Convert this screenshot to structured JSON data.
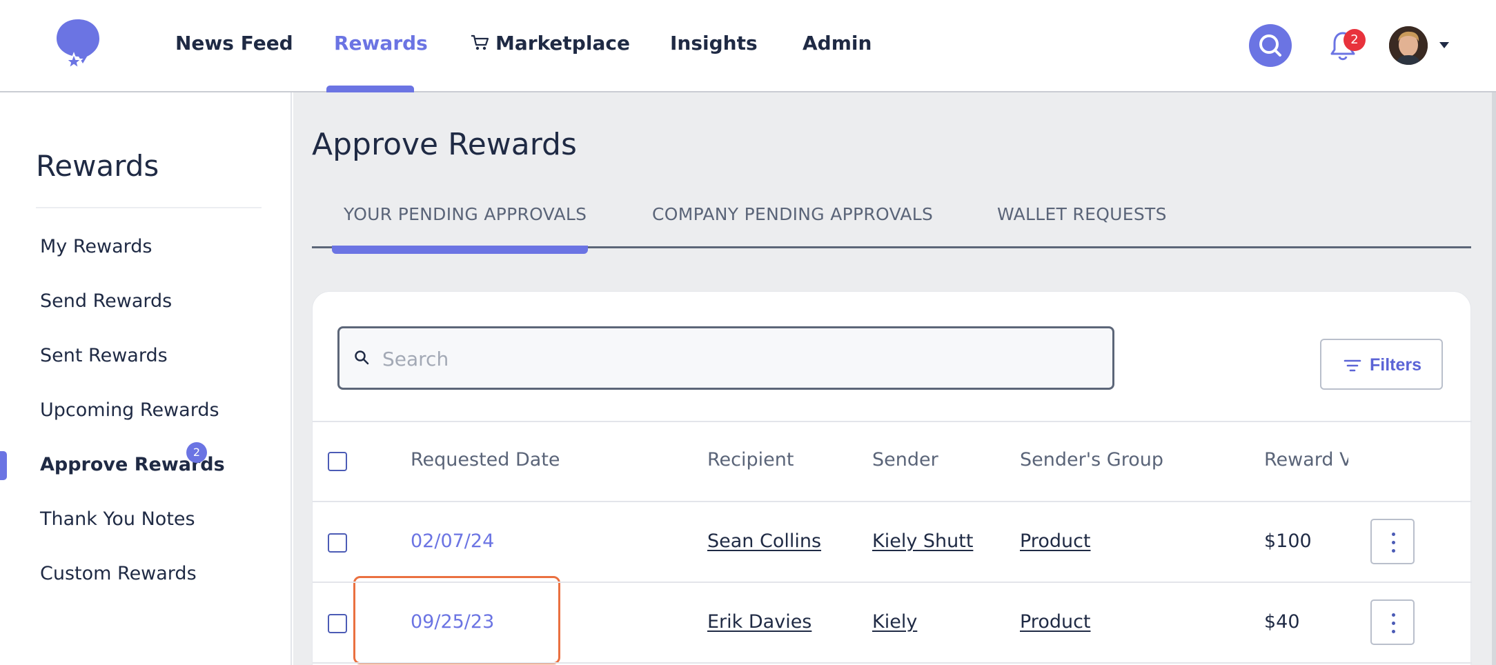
{
  "nav": {
    "items": [
      "News Feed",
      "Rewards",
      "Marketplace",
      "Insights",
      "Admin"
    ],
    "active": "Rewards",
    "notification_count": "2"
  },
  "sidebar": {
    "title": "Rewards",
    "items": [
      "My Rewards",
      "Send Rewards",
      "Sent Rewards",
      "Upcoming Rewards",
      "Approve Rewards",
      "Thank You Notes",
      "Custom Rewards"
    ],
    "active": "Approve Rewards",
    "approve_badge": "2"
  },
  "main": {
    "title": "Approve Rewards",
    "tabs": [
      "YOUR PENDING APPROVALS",
      "COMPANY PENDING APPROVALS",
      "WALLET REQUESTS"
    ],
    "active_tab": "YOUR PENDING APPROVALS",
    "search": {
      "placeholder": "Search",
      "value": ""
    },
    "filters_label": "Filters"
  },
  "table": {
    "columns": [
      "Requested Date",
      "Recipient",
      "Sender",
      "Sender's Group",
      "Reward Value"
    ],
    "rows": [
      {
        "date": "02/07/24",
        "recipient": "Sean Collins",
        "sender": "Kiely Shutt",
        "group": "Product",
        "value": "$100"
      },
      {
        "date": "09/25/23",
        "recipient": "Erik Davies",
        "sender": "Kiely",
        "group": "Product",
        "value": "$40"
      }
    ]
  },
  "colors": {
    "accent": "#6b74e3",
    "text": "#1f2a44",
    "highlight": "#ea7040",
    "badge_red": "#e8323c"
  },
  "icons": [
    "logo-icon",
    "cart-icon",
    "search-icon",
    "bell-icon",
    "avatar",
    "chevron-down-icon",
    "filter-icon",
    "more-vertical-icon"
  ]
}
